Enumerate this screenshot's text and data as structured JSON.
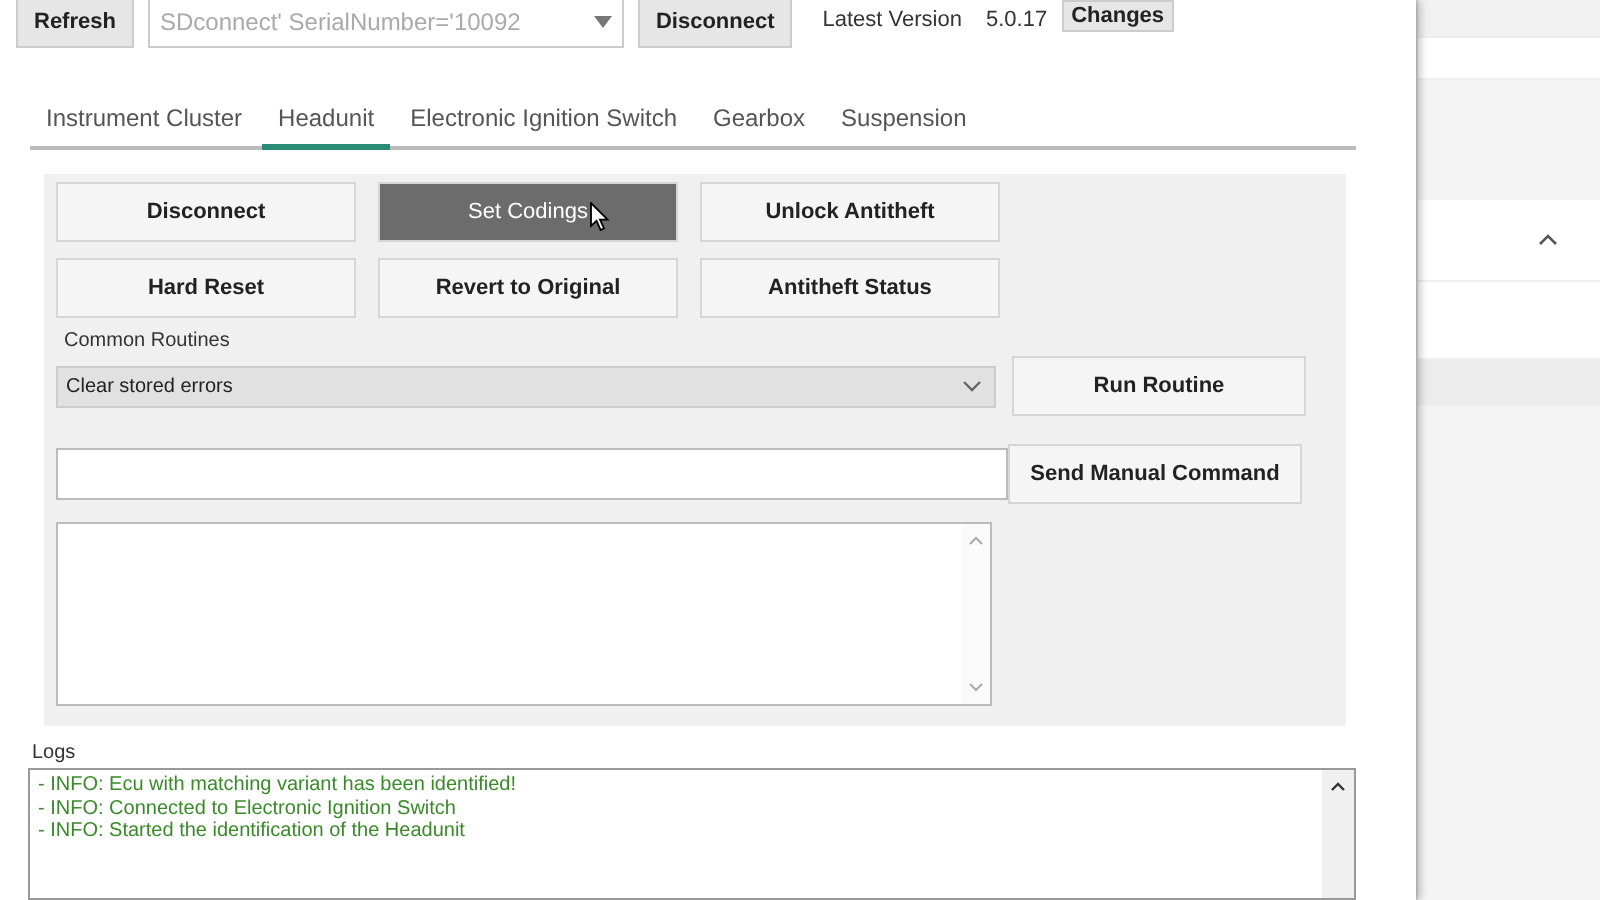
{
  "toolbar": {
    "refresh": "Refresh",
    "device": "SDconnect' SerialNumber='10092",
    "disconnect": "Disconnect",
    "latest_version_label": "Latest Version",
    "latest_version": "5.0.17",
    "changes": "Changes"
  },
  "tabs": [
    {
      "label": "Instrument Cluster",
      "selected": false
    },
    {
      "label": "Headunit",
      "selected": true
    },
    {
      "label": "Electronic Ignition Switch",
      "selected": false
    },
    {
      "label": "Gearbox",
      "selected": false
    },
    {
      "label": "Suspension",
      "selected": false
    }
  ],
  "actions": [
    {
      "label": "Disconnect",
      "pressed": false
    },
    {
      "label": "Set Codings",
      "pressed": true
    },
    {
      "label": "Unlock Antitheft",
      "pressed": false
    },
    {
      "label": "Hard Reset",
      "pressed": false
    },
    {
      "label": "Revert to Original",
      "pressed": false
    },
    {
      "label": "Antitheft Status",
      "pressed": false
    }
  ],
  "routines": {
    "label": "Common Routines",
    "value": "Clear stored errors",
    "button": "Run Routine"
  },
  "manual": {
    "button": "Send Manual Command"
  },
  "logs": {
    "label": "Logs",
    "lines": [
      "- INFO: Ecu with matching variant has been identified!",
      "- INFO: Connected to Electronic Ignition Switch",
      "- INFO: Started the identification of the Headunit"
    ]
  }
}
